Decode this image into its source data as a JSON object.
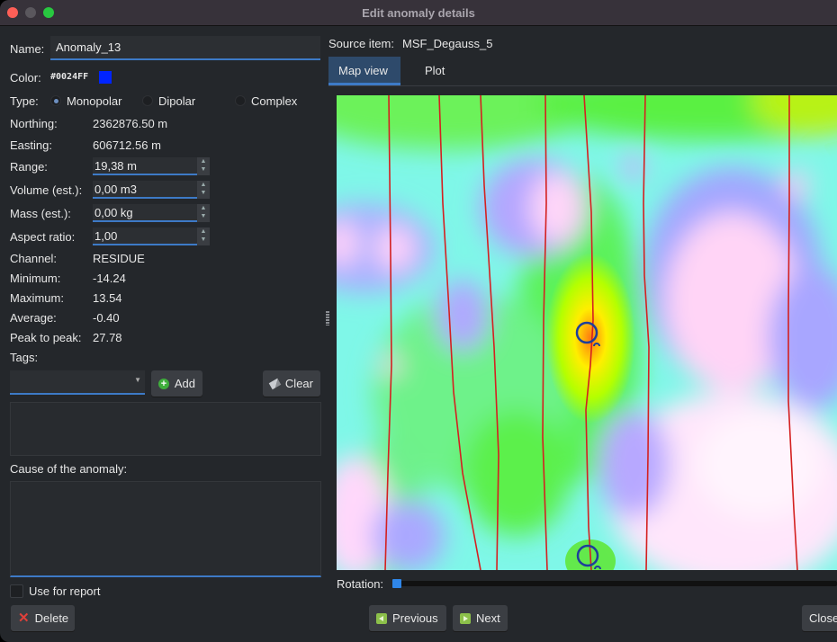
{
  "window": {
    "title": "Edit anomaly details"
  },
  "form": {
    "name_label": "Name:",
    "name_value": "Anomaly_13",
    "color_label": "Color:",
    "color_value": "#0024FF",
    "color_swatch": "#0024FF",
    "type_label": "Type:",
    "type_options": [
      {
        "label": "Monopolar",
        "selected": true
      },
      {
        "label": "Dipolar",
        "selected": false
      },
      {
        "label": "Complex",
        "selected": false
      }
    ],
    "northing_label": "Northing:",
    "northing_value": "2362876.50 m",
    "easting_label": "Easting:",
    "easting_value": "606712.56 m",
    "range_label": "Range:",
    "range_value": "19,38 m",
    "volume_label": "Volume (est.):",
    "volume_value": "0,00 m3",
    "mass_label": "Mass (est.):",
    "mass_value": "0,00 kg",
    "aspect_label": "Aspect ratio:",
    "aspect_value": "1,00",
    "channel_label": "Channel:",
    "channel_value": "RESIDUE",
    "minimum_label": "Minimum:",
    "minimum_value": "-14.24",
    "maximum_label": "Maximum:",
    "maximum_value": "13.54",
    "average_label": "Average:",
    "average_value": "-0.40",
    "p2p_label": "Peak to peak:",
    "p2p_value": "27.78",
    "tags_label": "Tags:",
    "tags_combo_value": "",
    "add_label": "Add",
    "clear_label": "Clear",
    "cause_label": "Cause of the anomaly:",
    "cause_value": "",
    "use_for_report_label": "Use for report",
    "use_for_report_checked": false,
    "delete_label": "Delete"
  },
  "right": {
    "source_label": "Source item:",
    "source_value": "MSF_Degauss_5",
    "tabs": [
      {
        "label": "Map view",
        "active": true
      },
      {
        "label": "Plot",
        "active": false
      }
    ],
    "rotation_label": "Rotation:",
    "rotation_value": 0,
    "previous_label": "Previous",
    "next_label": "Next",
    "close_label": "Close"
  },
  "colors": {
    "accent": "#3d7ac7",
    "track_lines": "#d42020",
    "anomaly_marker": "#1e3f9a"
  }
}
